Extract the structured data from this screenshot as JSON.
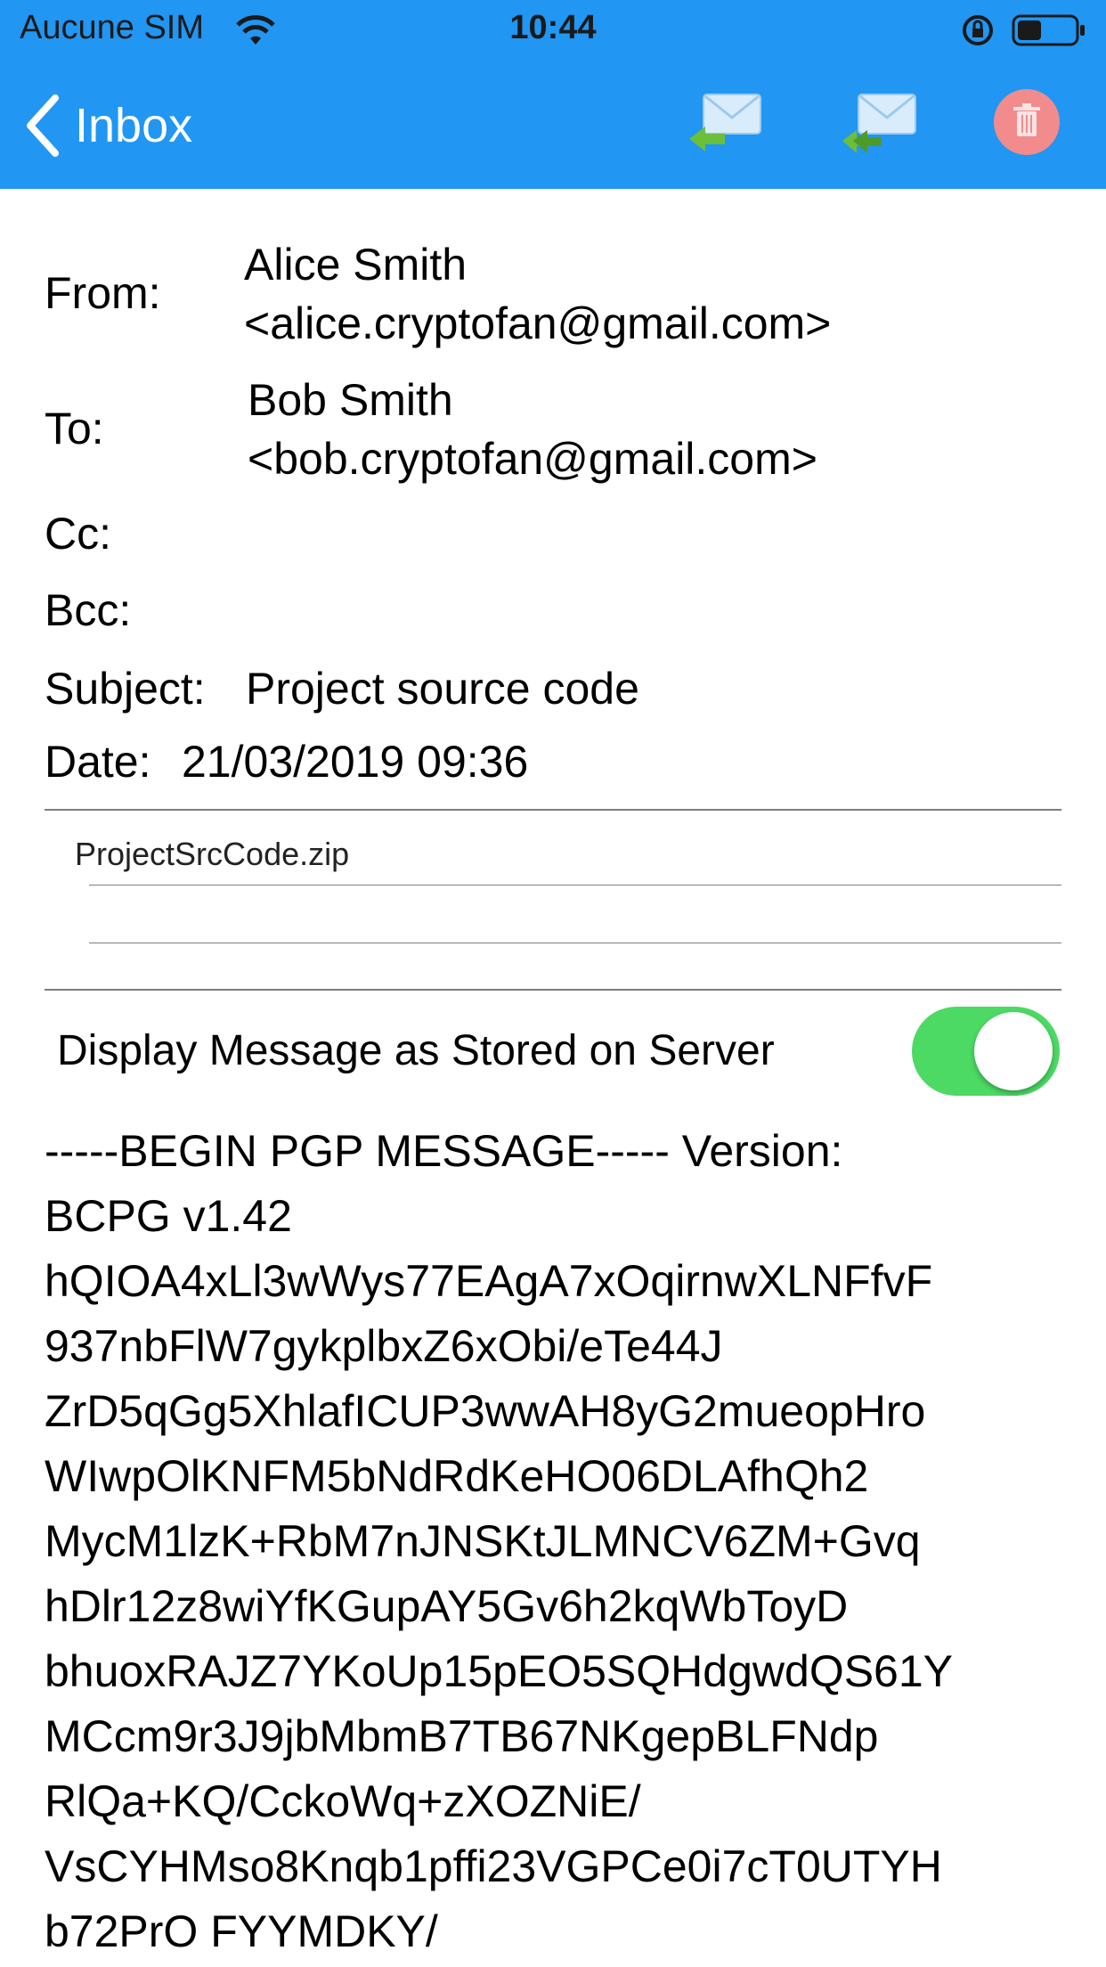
{
  "status_bar": {
    "carrier": "Aucune SIM",
    "time": "10:44"
  },
  "nav": {
    "back_label": "Inbox",
    "icons": [
      "chevron-left-icon",
      "reply-icon",
      "reply-all-icon",
      "trash-icon"
    ]
  },
  "headers": {
    "from_label": "From:",
    "from_name": "Alice Smith",
    "from_email": "<alice.cryptofan@gmail.com>",
    "to_label": "To:",
    "to_name": "Bob Smith",
    "to_email": "<bob.cryptofan@gmail.com>",
    "cc_label": "Cc:",
    "bcc_label": "Bcc:",
    "subject_label": "Subject:",
    "subject_value": "Project source code",
    "date_label": "Date:",
    "date_value": "21/03/2019 09:36"
  },
  "attachments": [
    "ProjectSrcCode.zip"
  ],
  "toggle": {
    "label": "Display Message as Stored on Server",
    "on": true
  },
  "message_body": "-----BEGIN PGP MESSAGE----- Version:\nBCPG v1.42\nhQIOA4xLl3wWys77EAgA7xOqirnwXLNFfvF\n937nbFlW7gykplbxZ6xObi/eTe44J\nZrD5qGg5XhlafICUP3wwAH8yG2mueopHro\nWIwpOlKNFM5bNdRdKeHO06DLAfhQh2\nMycM1lzK+RbM7nJNSKtJLMNCV6ZM+Gvq\nhDlr12z8wiYfKGupAY5Gv6h2kqWbToyD\nbhuoxRAJZ7YKoUp15pEO5SQHdgwdQS61Y\nMCcm9r3J9jbMbmB7TB67NKgepBLFNdp\nRlQa+KQ/CckoWq+zXOZNiE/\nVsCYHMso8Knqb1pffi23VGPCe0i7cT0UTYH\nb72PrO FYYMDKY/",
  "colors": {
    "nav_blue": "#2196F3",
    "toggle_green": "#4CD964",
    "delete_red": "#f28b8b",
    "reply_green": "#6bbf3a"
  }
}
